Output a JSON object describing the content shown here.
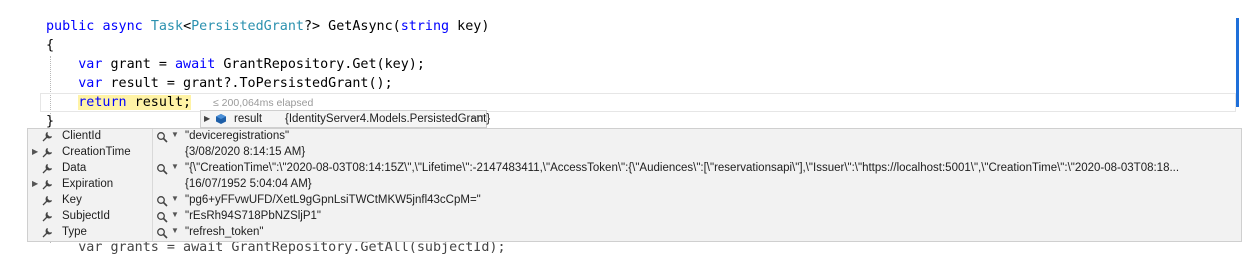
{
  "code": {
    "line1": {
      "kw1": "public",
      "kw2": "async",
      "type1": "Task",
      "lt": "<",
      "type2": "PersistedGrant",
      "rest": "?> GetAsync(",
      "kw3": "string",
      "tail": " key)"
    },
    "line2": {
      "text": "{"
    },
    "line3": {
      "kw1": "var",
      "mid": " grant = ",
      "kw2": "await",
      "tail": " GrantRepository.Get(key);"
    },
    "line4": {
      "kw1": "var",
      "tail": " result = grant?.ToPersistedGrant();"
    },
    "line5": {
      "kw1": "return",
      "tail": " result;"
    },
    "elapsed": "≤ 200,064ms elapsed",
    "line6": {
      "text": "}"
    },
    "line7": {
      "text": "var grants = await GrantRepository.GetAll(subjectId);"
    }
  },
  "datatip": {
    "name": "result",
    "value": "{IdentityServer4.Models.PersistedGrant}",
    "rows": [
      {
        "name": "ClientId",
        "value": "\"deviceregistrations\"",
        "expandable": false,
        "has_search": true
      },
      {
        "name": "CreationTime",
        "value": "{3/08/2020 8:14:15 AM}",
        "expandable": true,
        "has_search": false
      },
      {
        "name": "Data",
        "value": "\"{\\\"CreationTime\\\":\\\"2020-08-03T08:14:15Z\\\",\\\"Lifetime\\\":-2147483411,\\\"AccessToken\\\":{\\\"Audiences\\\":[\\\"reservationsapi\\\"],\\\"Issuer\\\":\\\"https://localhost:5001\\\",\\\"CreationTime\\\":\\\"2020-08-03T08:18...",
        "expandable": false,
        "has_search": true
      },
      {
        "name": "Expiration",
        "value": "{16/07/1952 5:04:04 AM}",
        "expandable": true,
        "has_search": false
      },
      {
        "name": "Key",
        "value": "\"pg6+yFFvwUFD/XetL9gGpnLsiTWCtMKW5jnfl43cCpM=\"",
        "expandable": false,
        "has_search": true
      },
      {
        "name": "SubjectId",
        "value": "\"rEsRh94S718PbNZSljP1\"",
        "expandable": false,
        "has_search": true
      },
      {
        "name": "Type",
        "value": "\"refresh_token\"",
        "expandable": false,
        "has_search": true
      }
    ]
  },
  "colors": {
    "keyword": "#0000ff",
    "type": "#2b91af",
    "highlight": "#fff3a6",
    "tip_bg": "#f2f2f2"
  }
}
